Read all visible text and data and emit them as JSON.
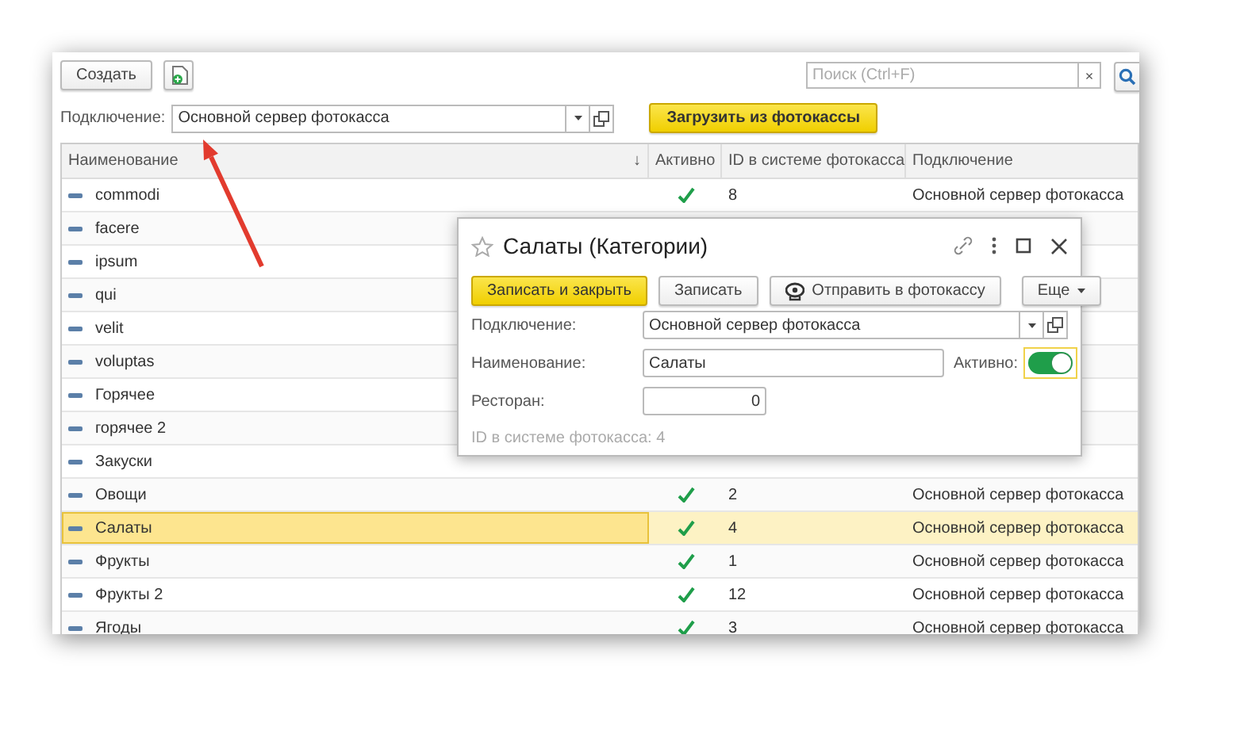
{
  "toolbar": {
    "create_button": "Создать",
    "search": {
      "placeholder": "Поиск (Ctrl+F)"
    },
    "clear_button": "×"
  },
  "filter": {
    "label": "Подключение:",
    "value": "Основной сервер фотокасса",
    "load_button": "Загрузить из фотокассы"
  },
  "table": {
    "columns": [
      {
        "label": "Наименование",
        "sort_mark": "↓"
      },
      {
        "label": "Активно"
      },
      {
        "label": "ID в системе фотокасса"
      },
      {
        "label": "Подключение"
      }
    ],
    "rows": [
      {
        "name": "commodi",
        "active": true,
        "id": "8",
        "connection": "Основной сервер фотокасса",
        "selected": false
      },
      {
        "name": "facere",
        "selected": false
      },
      {
        "name": "ipsum",
        "selected": false
      },
      {
        "name": "qui",
        "selected": false
      },
      {
        "name": "velit",
        "selected": false
      },
      {
        "name": "voluptas",
        "selected": false
      },
      {
        "name": "Горячее",
        "selected": false
      },
      {
        "name": "горячее 2",
        "selected": false
      },
      {
        "name": "Закуски",
        "selected": false
      },
      {
        "name": "Овощи",
        "active": true,
        "id": "2",
        "connection": "Основной сервер фотокасса",
        "selected": false
      },
      {
        "name": "Салаты",
        "active": true,
        "id": "4",
        "connection": "Основной сервер фотокасса",
        "selected": true
      },
      {
        "name": "Фрукты",
        "active": true,
        "id": "1",
        "connection": "Основной сервер фотокасса",
        "selected": false
      },
      {
        "name": "Фрукты 2",
        "active": true,
        "id": "12",
        "connection": "Основной сервер фотокасса",
        "selected": false
      },
      {
        "name": "Ягоды",
        "active": true,
        "id": "3",
        "connection": "Основной сервер фотокасса",
        "selected": false
      }
    ]
  },
  "dialog": {
    "title": "Салаты (Категории)",
    "buttons": [
      {
        "label": "Записать и закрыть",
        "kind": "primary"
      },
      {
        "label": "Записать",
        "kind": "plain"
      },
      {
        "label": "Отправить в фотокассу",
        "kind": "camera"
      },
      {
        "label": "Еще",
        "kind": "menu"
      }
    ],
    "connection": {
      "label": "Подключение:",
      "value": "Основной сервер фотокасса"
    },
    "name": {
      "label": "Наименование:",
      "value": "Салаты"
    },
    "active": {
      "label": "Активно:",
      "on": true
    },
    "restaurant": {
      "label": "Ресторан:",
      "value": "0"
    },
    "id_note": "ID в системе фотокасса: 4"
  }
}
